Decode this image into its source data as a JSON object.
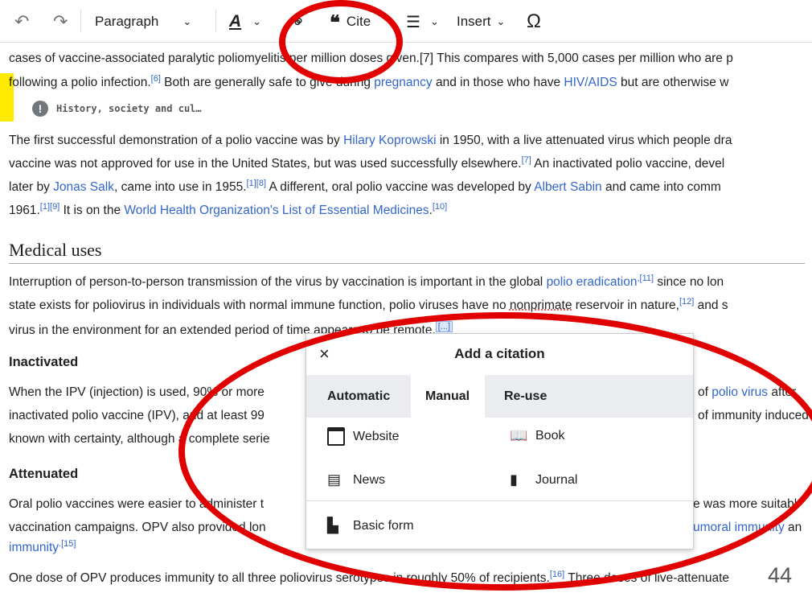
{
  "toolbar": {
    "undo_label": "↶",
    "redo_label": "↷",
    "paragraph_label": "Paragraph",
    "style_label": "A",
    "link_label": "⚭",
    "cite_label": "Cite",
    "list_label": "☰",
    "insert_label": "Insert",
    "special_label": "Ω"
  },
  "article": {
    "line1": "cases of vaccine-associated paralytic poliomyelitis per million doses given.[7] This compares with 5,000 cases per million who are p",
    "line2_a": "following a polio infection.",
    "line2_sup": "[6]",
    "line2_b": " Both are generally safe to give during ",
    "line2_link1": "pregnancy",
    "line2_c": " and in those who have ",
    "line2_link2": "HIV/AIDS",
    "line2_d": " but are otherwise w",
    "history_notice": "History, society and cul…",
    "p1_l1_a": "The first successful demonstration of a polio vaccine was by ",
    "p1_l1_link": "Hilary Koprowski",
    "p1_l1_b": " in 1950, with a live attenuated virus which people dra",
    "p1_l2_a": "vaccine was not approved for use in the United States, but was used successfully elsewhere.",
    "p1_l2_sup": "[7]",
    "p1_l2_b": " An inactivated polio vaccine, devel",
    "p1_l3_a": "later by ",
    "p1_l3_link1": "Jonas Salk",
    "p1_l3_b": ", came into use in 1955.",
    "p1_l3_sup": "[1][8]",
    "p1_l3_c": " A different, oral polio vaccine was developed by ",
    "p1_l3_link2": "Albert Sabin",
    "p1_l3_d": " and came into comm",
    "p1_l4_a": "1961.",
    "p1_l4_sup1": "[1][9]",
    "p1_l4_b": " It is on the ",
    "p1_l4_link": "World Health Organization's List of Essential Medicines",
    "p1_l4_c": ".",
    "p1_l4_sup2": "[10]",
    "heading_medical": "Medical uses",
    "m_l1_a": "Interruption of person-to-person transmission of the virus by vaccination is important in the global ",
    "m_l1_link": "polio eradication",
    "m_l1_sup": ",[11]",
    "m_l1_b": " since no lon",
    "m_l2_a": "state exists for poliovirus in individuals with normal immune function, polio viruses have no ",
    "m_l2_u": "nonprimate",
    "m_l2_b": " reservoir in nature,",
    "m_l2_sup": "[12]",
    "m_l2_c": " and s",
    "m_l3": "virus in the environment for an extended period of time appears to be remote.",
    "m_l3_marker": "[...]",
    "heading_inactivated": "Inactivated",
    "i_l1_a": "When the IPV (injection) is used, 90% or more",
    "i_l1_b": "of ",
    "i_l1_link": "polio virus",
    "i_l1_c": " after",
    "i_l2_a": "inactivated polio vaccine (IPV), and at least 99",
    "i_l2_b": "of immunity induced",
    "i_l3": "known with certainty, although a complete serie",
    "heading_attenuated": "Attenuated",
    "a_l1_a": "Oral polio vaccines were easier to administer t",
    "a_l1_b": "e was more suitabl",
    "a_l2_a": "vaccination campaigns. OPV also provided lon",
    "a_l2_link": "umoral immunity",
    "a_l2_b": " an",
    "a_l3_link": "immunity",
    "a_l3_sup": ".[15]",
    "last_a": "One dose of OPV produces immunity to all three poliovirus serotypes in roughly 50% of recipients.",
    "last_sup": "[16]",
    "last_b": " Three doses of live-attenuate"
  },
  "dialog": {
    "title": "Add a citation",
    "close": "×",
    "tabs": [
      "Automatic",
      "Manual",
      "Re-use"
    ],
    "active_tab": "Manual",
    "options": {
      "website": "Website",
      "book": "Book",
      "news": "News",
      "journal": "Journal",
      "basic": "Basic form"
    }
  },
  "slide_number": "44",
  "colors": {
    "link": "#3366cc",
    "annotation_red": "#e00000",
    "highlight": "#ffe900"
  }
}
